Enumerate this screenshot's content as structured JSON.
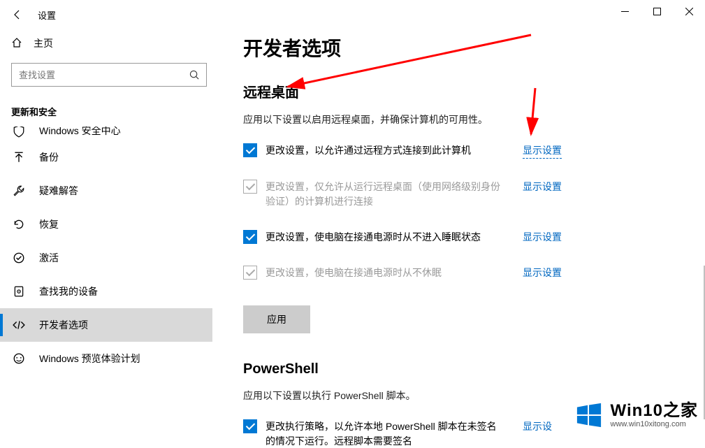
{
  "titlebar": {
    "app_name": "设置"
  },
  "sidebar": {
    "home": "主页",
    "search_placeholder": "查找设置",
    "category": "更新和安全",
    "items": [
      {
        "icon": "shield",
        "label": "Windows 安全中心",
        "cut": true
      },
      {
        "icon": "backup",
        "label": "备份"
      },
      {
        "icon": "troubleshoot",
        "label": "疑难解答"
      },
      {
        "icon": "recovery",
        "label": "恢复"
      },
      {
        "icon": "activation",
        "label": "激活"
      },
      {
        "icon": "findmydevice",
        "label": "查找我的设备"
      },
      {
        "icon": "developer",
        "label": "开发者选项",
        "active": true
      },
      {
        "icon": "insider",
        "label": "Windows 预览体验计划"
      }
    ]
  },
  "page": {
    "title": "开发者选项",
    "remote": {
      "heading": "远程桌面",
      "desc": "应用以下设置以启用远程桌面，并确保计算机的可用性。",
      "opts": [
        {
          "checked": true,
          "disabled": false,
          "text": "更改设置，以允许通过远程方式连接到此计算机",
          "link": "显示设置"
        },
        {
          "checked": true,
          "disabled": true,
          "text": "更改设置，仅允许从运行远程桌面（使用网络级别身份验证）的计算机进行连接",
          "link": "显示设置"
        },
        {
          "checked": true,
          "disabled": false,
          "text": "更改设置，使电脑在接通电源时从不进入睡眠状态",
          "link": "显示设置"
        },
        {
          "checked": true,
          "disabled": true,
          "text": "更改设置，使电脑在接通电源时从不休眠",
          "link": "显示设置"
        }
      ],
      "apply": "应用"
    },
    "powershell": {
      "heading": "PowerShell",
      "desc": "应用以下设置以执行 PowerShell 脚本。",
      "opts": [
        {
          "checked": true,
          "disabled": false,
          "text": "更改执行策略，以允许本地 PowerShell 脚本在未签名的情况下运行。远程脚本需要签名",
          "link": "显示设"
        }
      ]
    }
  },
  "watermark": {
    "brand": "Win10",
    "suffix": "之家",
    "url": "www.win10xitong.com"
  }
}
